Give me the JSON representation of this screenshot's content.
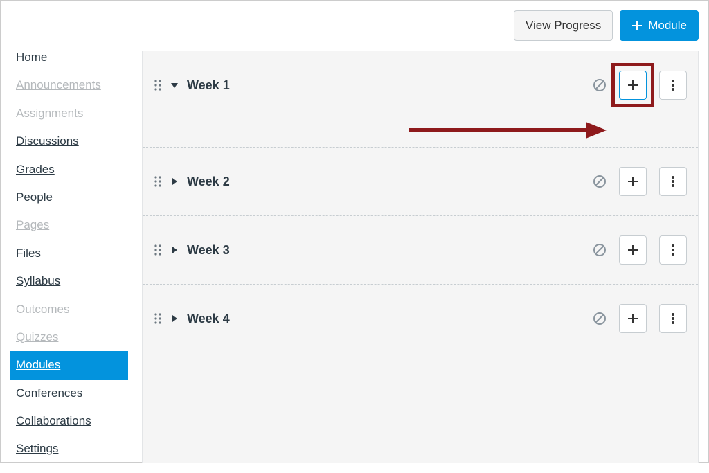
{
  "topbar": {
    "view_progress_label": "View Progress",
    "add_module_label": "Module"
  },
  "sidebar": {
    "items": [
      {
        "label": "Home",
        "state": "enabled"
      },
      {
        "label": "Announcements",
        "state": "disabled"
      },
      {
        "label": "Assignments",
        "state": "disabled"
      },
      {
        "label": "Discussions",
        "state": "enabled"
      },
      {
        "label": "Grades",
        "state": "enabled"
      },
      {
        "label": "People",
        "state": "enabled"
      },
      {
        "label": "Pages",
        "state": "disabled"
      },
      {
        "label": "Files",
        "state": "enabled"
      },
      {
        "label": "Syllabus",
        "state": "enabled"
      },
      {
        "label": "Outcomes",
        "state": "disabled"
      },
      {
        "label": "Quizzes",
        "state": "disabled"
      },
      {
        "label": "Modules",
        "state": "active"
      },
      {
        "label": "Conferences",
        "state": "enabled"
      },
      {
        "label": "Collaborations",
        "state": "enabled"
      },
      {
        "label": "Settings",
        "state": "enabled"
      }
    ]
  },
  "modules": [
    {
      "title": "Week 1",
      "expanded": true,
      "highlighted_add": true
    },
    {
      "title": "Week 2",
      "expanded": false,
      "highlighted_add": false
    },
    {
      "title": "Week 3",
      "expanded": false,
      "highlighted_add": false
    },
    {
      "title": "Week 4",
      "expanded": false,
      "highlighted_add": false
    }
  ],
  "annotation": {
    "arrow_color": "#8e1a1c",
    "highlight_color": "#8e1a1c"
  }
}
